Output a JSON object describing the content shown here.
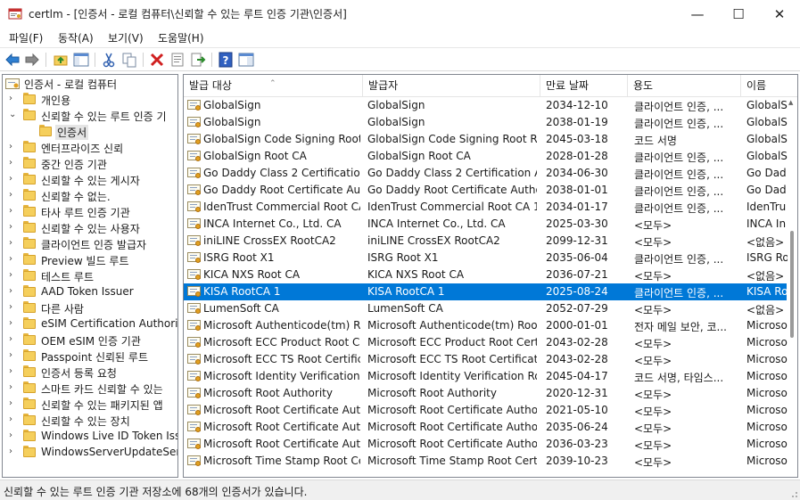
{
  "window": {
    "title": "certlm - [인증서 - 로컬 컴퓨터\\신뢰할 수 있는 루트 인증 기관\\인증서]",
    "minimize": "—",
    "maximize": "☐",
    "close": "✕"
  },
  "menu": {
    "items": [
      "파일(F)",
      "동작(A)",
      "보기(V)",
      "도움말(H)"
    ]
  },
  "toolbar": {
    "icons": [
      "back-icon",
      "forward-icon",
      "up-folder-icon",
      "show-hide-tree-icon",
      "cut-icon",
      "copy-icon",
      "delete-icon",
      "properties-icon",
      "export-icon",
      "help-icon",
      "console-icon"
    ]
  },
  "tree": {
    "root": "인증서 - 로컬 컴퓨터",
    "items": [
      {
        "label": "개인용",
        "level": 1,
        "chevron": "›"
      },
      {
        "label": "신뢰할 수 있는 루트 인증 기",
        "level": 1,
        "chevron": "⌄"
      },
      {
        "label": "인증서",
        "level": 2,
        "chevron": ""
      },
      {
        "label": "엔터프라이즈 신뢰",
        "level": 1,
        "chevron": "›"
      },
      {
        "label": "중간 인증 기관",
        "level": 1,
        "chevron": "›"
      },
      {
        "label": "신뢰할 수 있는 게시자",
        "level": 1,
        "chevron": "›"
      },
      {
        "label": "신뢰할 수 없는.",
        "level": 1,
        "chevron": "›"
      },
      {
        "label": "타사 루트 인증 기관",
        "level": 1,
        "chevron": "›"
      },
      {
        "label": "신뢰할 수 있는 사용자",
        "level": 1,
        "chevron": "›"
      },
      {
        "label": "클라이언트 인증 발급자",
        "level": 1,
        "chevron": "›"
      },
      {
        "label": "Preview 빌드 루트",
        "level": 1,
        "chevron": "›"
      },
      {
        "label": "테스트 루트",
        "level": 1,
        "chevron": "›"
      },
      {
        "label": "AAD Token Issuer",
        "level": 1,
        "chevron": "›"
      },
      {
        "label": "다른 사람",
        "level": 1,
        "chevron": "›"
      },
      {
        "label": "eSIM Certification Authoritie",
        "level": 1,
        "chevron": "›"
      },
      {
        "label": "OEM eSIM 인증 기관",
        "level": 1,
        "chevron": "›"
      },
      {
        "label": "Passpoint 신뢰된 루트",
        "level": 1,
        "chevron": "›"
      },
      {
        "label": "인증서 등록 요청",
        "level": 1,
        "chevron": "›"
      },
      {
        "label": "스마트 카드 신뢰할 수 있는",
        "level": 1,
        "chevron": "›"
      },
      {
        "label": "신뢰할 수 있는 패키지된 앱",
        "level": 1,
        "chevron": "›"
      },
      {
        "label": "신뢰할 수 있는 장치",
        "level": 1,
        "chevron": "›"
      },
      {
        "label": "Windows Live ID Token Issue",
        "level": 1,
        "chevron": "›"
      },
      {
        "label": "WindowsServerUpdateServic",
        "level": 1,
        "chevron": "›"
      }
    ]
  },
  "list": {
    "columns": [
      "발급 대상",
      "발급자",
      "만료 날짜",
      "용도",
      "이름"
    ],
    "sort_glyph": "⌃",
    "rows": [
      [
        "GlobalSign",
        "GlobalSign",
        "2034-12-10",
        "클라이언트 인증, ...",
        "GlobalS"
      ],
      [
        "GlobalSign",
        "GlobalSign",
        "2038-01-19",
        "클라이언트 인증, ...",
        "GlobalS"
      ],
      [
        "GlobalSign Code Signing Root...",
        "GlobalSign Code Signing Root R...",
        "2045-03-18",
        "코드 서명",
        "GlobalS"
      ],
      [
        "GlobalSign Root CA",
        "GlobalSign Root CA",
        "2028-01-28",
        "클라이언트 인증, ...",
        "GlobalS"
      ],
      [
        "Go Daddy Class 2 Certification...",
        "Go Daddy Class 2 Certification A...",
        "2034-06-30",
        "클라이언트 인증, ...",
        "Go Dad"
      ],
      [
        "Go Daddy Root Certificate Aut...",
        "Go Daddy Root Certificate Autho...",
        "2038-01-01",
        "클라이언트 인증, ...",
        "Go Dad"
      ],
      [
        "IdenTrust Commercial Root CA...",
        "IdenTrust Commercial Root CA 1",
        "2034-01-17",
        "클라이언트 인증, ...",
        "IdenTru"
      ],
      [
        "INCA Internet Co., Ltd. CA",
        "INCA Internet Co., Ltd. CA",
        "2025-03-30",
        "<모두>",
        "INCA In"
      ],
      [
        "iniLINE CrossEX RootCA2",
        "iniLINE CrossEX RootCA2",
        "2099-12-31",
        "<모두>",
        "<없음>"
      ],
      [
        "ISRG Root X1",
        "ISRG Root X1",
        "2035-06-04",
        "클라이언트 인증, ...",
        "ISRG Ro"
      ],
      [
        "KICA NXS Root CA",
        "KICA NXS Root CA",
        "2036-07-21",
        "<모두>",
        "<없음>"
      ],
      [
        "KISA RootCA 1",
        "KISA RootCA 1",
        "2025-08-24",
        "클라이언트 인증, ...",
        "KISA Ro"
      ],
      [
        "LumenSoft CA",
        "LumenSoft CA",
        "2052-07-29",
        "<모두>",
        "<없음>"
      ],
      [
        "Microsoft Authenticode(tm) R...",
        "Microsoft Authenticode(tm) Root...",
        "2000-01-01",
        "전자 메일 보안, 코...",
        "Microso"
      ],
      [
        "Microsoft ECC Product Root C...",
        "Microsoft ECC Product Root Cert...",
        "2043-02-28",
        "<모두>",
        "Microso"
      ],
      [
        "Microsoft ECC TS Root Certific...",
        "Microsoft ECC TS Root Certificat...",
        "2043-02-28",
        "<모두>",
        "Microso"
      ],
      [
        "Microsoft Identity Verification ...",
        "Microsoft Identity Verification Ro...",
        "2045-04-17",
        "코드 서명, 타임스...",
        "Microso"
      ],
      [
        "Microsoft Root Authority",
        "Microsoft Root Authority",
        "2020-12-31",
        "<모두>",
        "Microso"
      ],
      [
        "Microsoft Root Certificate Aut...",
        "Microsoft Root Certificate Author...",
        "2021-05-10",
        "<모두>",
        "Microso"
      ],
      [
        "Microsoft Root Certificate Aut...",
        "Microsoft Root Certificate Author...",
        "2035-06-24",
        "<모두>",
        "Microso"
      ],
      [
        "Microsoft Root Certificate Aut...",
        "Microsoft Root Certificate Author...",
        "2036-03-23",
        "<모두>",
        "Microso"
      ],
      [
        "Microsoft Time Stamp Root Ce...",
        "Microsoft Time Stamp Root Certi...",
        "2039-10-23",
        "<모두>",
        "Microso"
      ]
    ],
    "selected_index": 11
  },
  "status": {
    "text": "신뢰할 수 있는 루트 인증 기관 저장소에 68개의 인증서가 있습니다."
  },
  "colors": {
    "selection": "#0078d7",
    "tree_selection": "#e5e5e5",
    "folder": "#f5cf5c"
  }
}
